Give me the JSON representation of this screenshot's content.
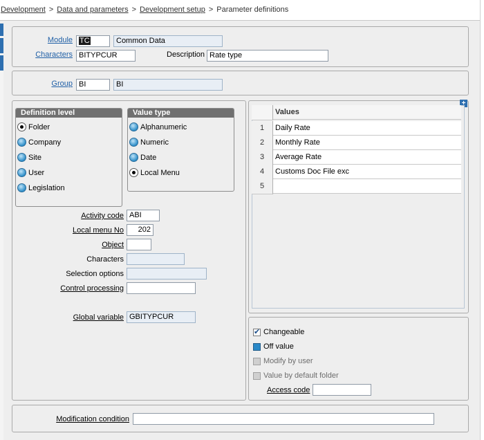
{
  "breadcrumb": {
    "items": [
      "Development",
      "Data and parameters",
      "Development setup"
    ],
    "current": "Parameter definitions"
  },
  "header": {
    "module_label": "Module",
    "module_code": "TC",
    "module_name": "Common Data",
    "characters_label": "Characters",
    "characters_value": "BITYPCUR",
    "description_label": "Description",
    "description_value": "Rate type"
  },
  "group": {
    "label": "Group",
    "code": "BI",
    "name": "BI"
  },
  "definition_level": {
    "title": "Definition level",
    "options": [
      "Folder",
      "Company",
      "Site",
      "User",
      "Legislation"
    ],
    "selected": "Folder"
  },
  "value_type": {
    "title": "Value type",
    "options": [
      "Alphanumeric",
      "Numeric",
      "Date",
      "Local Menu"
    ],
    "selected": "Local Menu"
  },
  "fields": {
    "activity_code_label": "Activity code",
    "activity_code": "ABI",
    "local_menu_label": "Local menu No",
    "local_menu": "202",
    "object_label": "Object",
    "object": "",
    "characters_label": "Characters",
    "characters": "",
    "selection_label": "Selection options",
    "selection": "",
    "control_label": "Control processing",
    "control": "",
    "global_label": "Global variable",
    "global": "GBITYPCUR"
  },
  "values_table": {
    "header": "Values",
    "rows": [
      {
        "n": "1",
        "value": "Daily Rate"
      },
      {
        "n": "2",
        "value": "Monthly Rate"
      },
      {
        "n": "3",
        "value": "Average Rate"
      },
      {
        "n": "4",
        "value": "Customs Doc File exc"
      },
      {
        "n": "5",
        "value": ""
      }
    ]
  },
  "options": {
    "changeable": "Changeable",
    "off_value": "Off value",
    "modify_by_user": "Modify by user",
    "value_by_default_folder": "Value by default folder",
    "access_code_label": "Access code",
    "access_code": ""
  },
  "footer": {
    "modification_label": "Modification condition",
    "modification": ""
  },
  "colors": {
    "accent": "#2e6fb0",
    "link": "#1f5fa6",
    "groupbox_title": "#707070"
  }
}
